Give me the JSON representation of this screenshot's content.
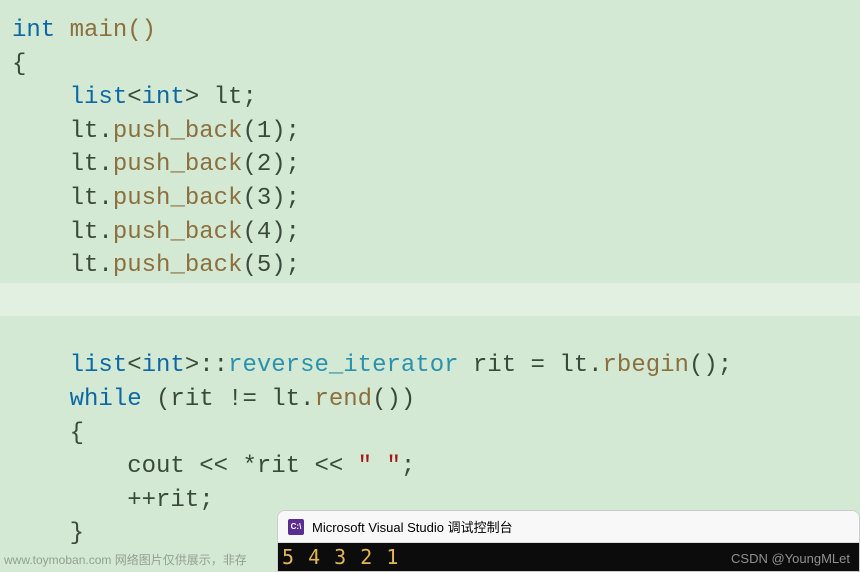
{
  "code": {
    "line1_int": "int",
    "line1_main": " main()",
    "line2": "{",
    "line3_indent": "    ",
    "line3_list": "list",
    "line3_lt": "<",
    "line3_int": "int",
    "line3_gt": ">",
    "line3_var": " lt;",
    "line4_indent": "    ",
    "line4_obj": "lt.",
    "line4_method": "push_back",
    "line4_args": "(1);",
    "line5_indent": "    ",
    "line5_obj": "lt.",
    "line5_method": "push_back",
    "line5_args": "(2);",
    "line6_indent": "    ",
    "line6_obj": "lt.",
    "line6_method": "push_back",
    "line6_args": "(3);",
    "line7_indent": "    ",
    "line7_obj": "lt.",
    "line7_method": "push_back",
    "line7_args": "(4);",
    "line8_indent": "    ",
    "line8_obj": "lt.",
    "line8_method": "push_back",
    "line8_args": "(5);",
    "line10_indent": "    ",
    "line10_list": "list",
    "line10_lt": "<",
    "line10_int": "int",
    "line10_gt": ">::",
    "line10_riter": "reverse_iterator",
    "line10_rit": " rit = lt.",
    "line10_rbegin": "rbegin",
    "line10_end": "();",
    "line11_indent": "    ",
    "line11_while": "while",
    "line11_cond1": " (rit != lt.",
    "line11_rend": "rend",
    "line11_cond2": "())",
    "line12": "    {",
    "line13_indent": "        ",
    "line13_cout": "cout << *rit << ",
    "line13_str": "\" \"",
    "line13_semi": ";",
    "line14": "        ++rit;",
    "line15": "    }"
  },
  "console": {
    "title": "Microsoft Visual Studio 调试控制台",
    "icon_text": "C:\\",
    "output": "5 4 3 2 1"
  },
  "watermarks": {
    "left": "www.toymoban.com 网络图片仅供展示，非存",
    "right": "CSDN @YoungMLet"
  }
}
